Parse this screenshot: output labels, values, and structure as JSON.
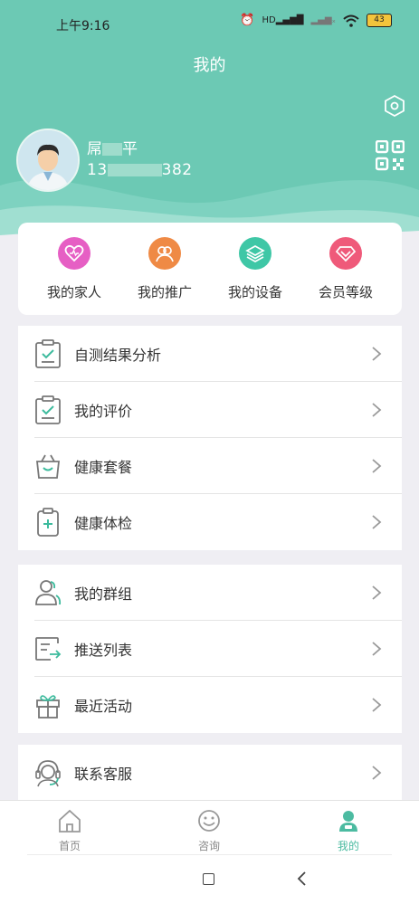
{
  "status_bar": {
    "time": "上午9:16",
    "hd": "HD",
    "battery": "43"
  },
  "header": {
    "title": "我的"
  },
  "user": {
    "name_start": "屌",
    "name_end": "平",
    "phone_start": "13",
    "phone_end": "382"
  },
  "quick_actions": [
    {
      "label": "我的家人",
      "icon": "heart-icon",
      "color": "#e65fc4"
    },
    {
      "label": "我的推广",
      "icon": "people-icon",
      "color": "#ef8a45"
    },
    {
      "label": "我的设备",
      "icon": "layers-icon",
      "color": "#3fc7a6"
    },
    {
      "label": "会员等级",
      "icon": "diamond-icon",
      "color": "#ef5a7a"
    }
  ],
  "menu_group1": [
    {
      "label": "自测结果分析",
      "icon": "clipboard-check-icon"
    },
    {
      "label": "我的评价",
      "icon": "clipboard-check-icon"
    },
    {
      "label": "健康套餐",
      "icon": "basket-icon"
    },
    {
      "label": "健康体检",
      "icon": "medical-clipboard-icon"
    }
  ],
  "menu_group2": [
    {
      "label": "我的群组",
      "icon": "group-icon"
    },
    {
      "label": "推送列表",
      "icon": "send-list-icon"
    },
    {
      "label": "最近活动",
      "icon": "gift-icon"
    }
  ],
  "menu_group3": [
    {
      "label": "联系客服",
      "icon": "headset-icon"
    }
  ],
  "tabs": [
    {
      "label": "首页",
      "icon": "home-icon",
      "active": false
    },
    {
      "label": "咨询",
      "icon": "smile-icon",
      "active": false
    },
    {
      "label": "我的",
      "icon": "person-icon",
      "active": true
    }
  ],
  "colors": {
    "header": "#6cc9b4",
    "accent": "#4cbba1"
  }
}
